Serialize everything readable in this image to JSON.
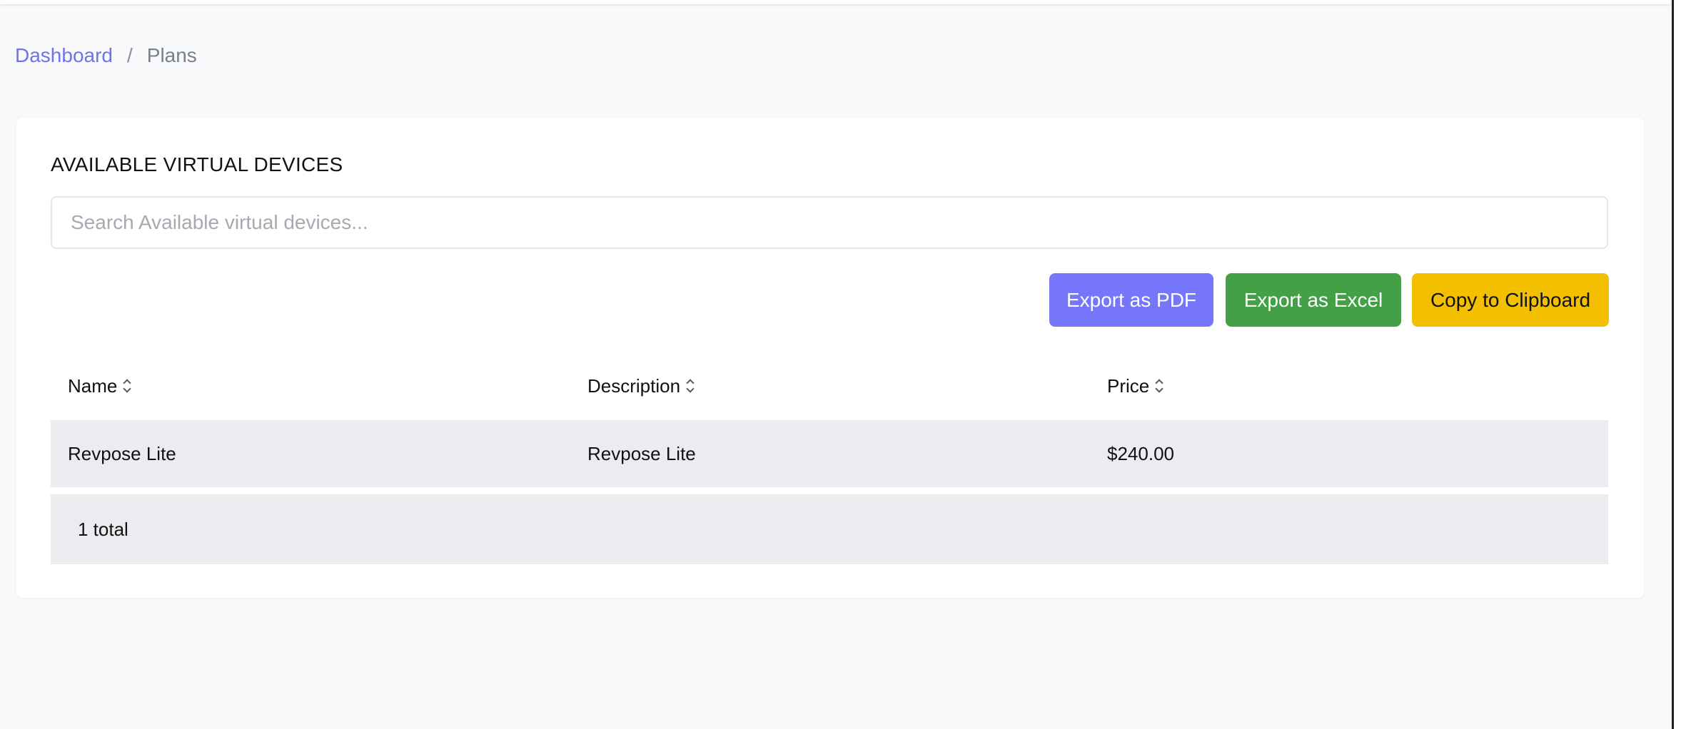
{
  "breadcrumb": {
    "items": [
      {
        "label": "Dashboard"
      },
      {
        "label": "Plans"
      }
    ],
    "separator": "/"
  },
  "panel": {
    "title": "AVAILABLE VIRTUAL DEVICES",
    "search": {
      "placeholder": "Search Available virtual devices...",
      "value": ""
    },
    "actions": {
      "export_pdf": "Export as PDF",
      "export_excel": "Export as Excel",
      "copy_clipboard": "Copy to Clipboard"
    },
    "table": {
      "columns": [
        {
          "label": "Name",
          "sort_icon": "sort-updown-icon"
        },
        {
          "label": "Description",
          "sort_icon": "sort-updown-icon"
        },
        {
          "label": "Price",
          "sort_icon": "sort-updown-icon"
        }
      ],
      "rows": [
        {
          "name": "Revpose Lite",
          "description": "Revpose Lite",
          "price": "$240.00"
        }
      ],
      "total_label": "1 total"
    }
  },
  "colors": {
    "link": "#6f73e8",
    "pdf_button": "#7676fb",
    "excel_button": "#43a047",
    "clipboard_button": "#f2c000",
    "row_background": "#ebecef",
    "page_background": "#f8f9fb"
  }
}
